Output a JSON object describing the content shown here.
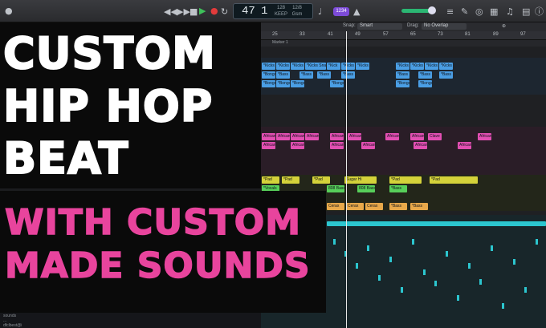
{
  "transport": {
    "bar": "47",
    "beat": "1",
    "tempo": "128",
    "tempo_unit": "KEEP",
    "signature": "12/8",
    "key": "Gsm",
    "badge": "1234"
  },
  "snap": {
    "snap_label": "Snap:",
    "snap_value": "Smart",
    "drag_label": "Drag:",
    "drag_value": "No Overlap"
  },
  "ruler": {
    "bars": [
      "25",
      "33",
      "41",
      "49",
      "57",
      "65",
      "73",
      "81",
      "89",
      "97"
    ],
    "marker": "Marker 1"
  },
  "title": {
    "lines": [
      "CUSTOM",
      "HIP HOP",
      "BEAT"
    ]
  },
  "subtitle": {
    "lines": [
      "WITH CUSTOM",
      "MADE SOUNDS"
    ]
  },
  "footer": {
    "lines": [
      "sounds",
      "...",
      "dfclbest@i"
    ]
  },
  "regions": {
    "blue_row1": [
      "*Kicks",
      "*Kicks",
      "*Kicks",
      "*Kicks Snare",
      "*Kick",
      "*Kicks",
      "*Kicks",
      "*Kicks",
      "*Kicks",
      "*Kicks",
      "*Kicks"
    ],
    "blue_row2": [
      "*Bongo",
      "*Bass",
      "*Bass",
      "*Bass",
      "*Bass",
      "*Bass",
      "*Bass",
      "*Bass"
    ],
    "blue_row3": [
      "*Bongo",
      "*Bongo",
      "*Bongo",
      "*Bongo",
      "*Bongo",
      "*Bongo"
    ],
    "pink_row1": [
      "African",
      "African",
      "African",
      "African",
      "African",
      "African",
      "African",
      "African",
      "Clave",
      "African"
    ],
    "pink_row2": [
      "African",
      "African",
      "African",
      "African",
      "African",
      "African"
    ],
    "yellow_row": [
      "*Pad",
      "*Pad",
      "*Pad",
      "Sugar Hi",
      "*Pad",
      "*Pad"
    ],
    "green_row": [
      "*Vocals",
      "808 Bass",
      "808 Bass",
      "*Bass"
    ],
    "orange_row": [
      "Cerax",
      "Cerax",
      "Cerax",
      "*Bass",
      "*Bass"
    ]
  }
}
